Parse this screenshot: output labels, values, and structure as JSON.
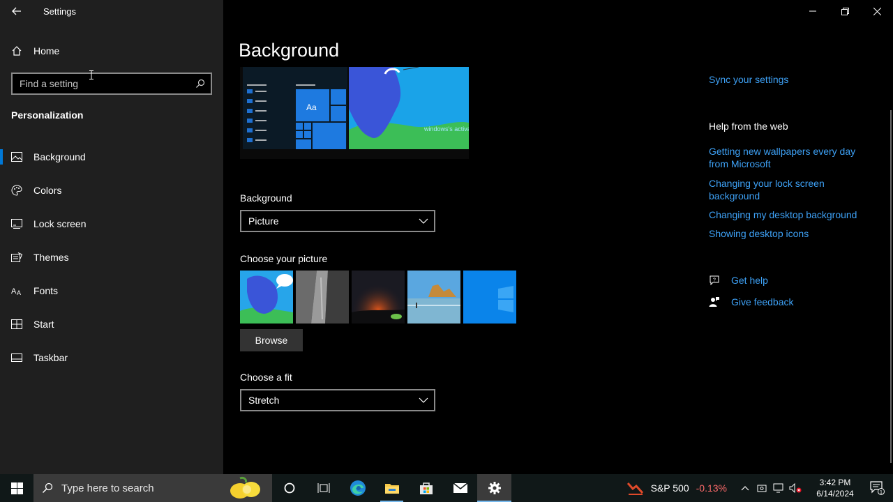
{
  "window": {
    "title": "Settings"
  },
  "sidebar": {
    "home_label": "Home",
    "search_placeholder": "Find a setting",
    "section_title": "Personalization",
    "items": [
      {
        "label": "Background",
        "icon": "picture-icon",
        "active": true
      },
      {
        "label": "Colors",
        "icon": "palette-icon",
        "active": false
      },
      {
        "label": "Lock screen",
        "icon": "lock-screen-icon",
        "active": false
      },
      {
        "label": "Themes",
        "icon": "themes-icon",
        "active": false
      },
      {
        "label": "Fonts",
        "icon": "fonts-icon",
        "active": false
      },
      {
        "label": "Start",
        "icon": "start-icon",
        "active": false
      },
      {
        "label": "Taskbar",
        "icon": "taskbar-icon",
        "active": false
      }
    ]
  },
  "main": {
    "page_title": "Background",
    "preview": {
      "tile_text": "Aa",
      "watermark": "windows's activated"
    },
    "background_label": "Background",
    "background_value": "Picture",
    "choose_picture_label": "Choose your picture",
    "browse_label": "Browse",
    "choose_fit_label": "Choose a fit",
    "fit_value": "Stretch"
  },
  "right_panel": {
    "sync_link": "Sync your settings",
    "help_title": "Help from the web",
    "help_links": [
      "Getting new wallpapers every day from Microsoft",
      "Changing your lock screen background",
      "Changing my desktop background",
      "Showing desktop icons"
    ],
    "get_help": "Get help",
    "give_feedback": "Give feedback"
  },
  "taskbar": {
    "search_placeholder": "Type here to search",
    "stock_name": "S&P 500",
    "stock_change": "-0.13%",
    "time": "3:42 PM",
    "date": "6/14/2024",
    "notification_count": "1"
  },
  "colors": {
    "accent": "#0078d7",
    "link": "#3ea2f7",
    "sidebar_bg": "#1f1f1f"
  }
}
